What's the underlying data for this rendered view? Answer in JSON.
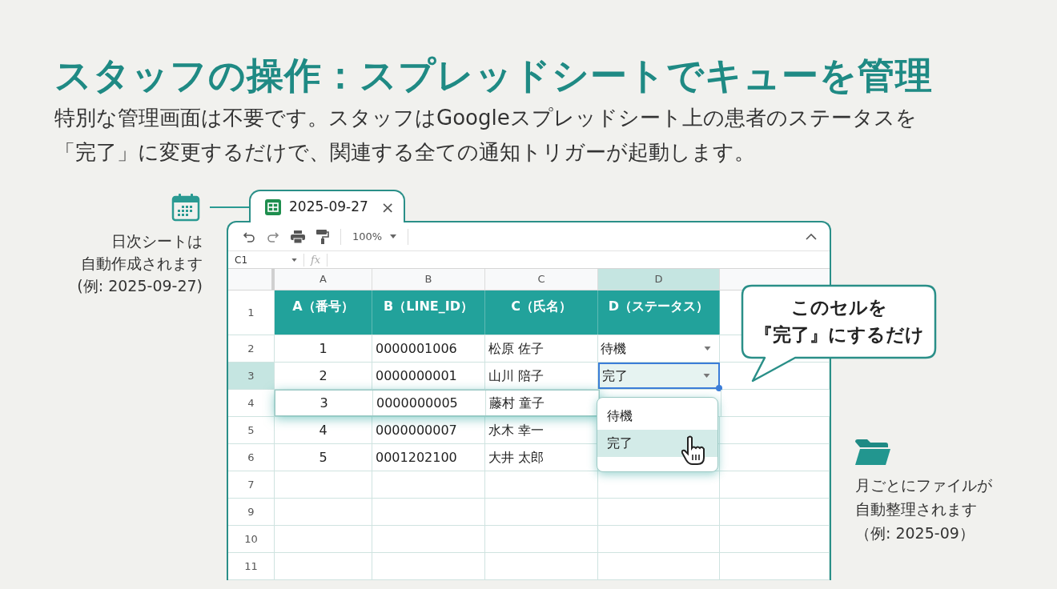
{
  "title": "スタッフの操作：スプレッドシートでキューを管理",
  "description_lines": [
    "特別な管理画面は不要です。スタッフはGoogleスプレッドシート上の患者のステータスを",
    "「完了」に変更するだけで、関連する全ての通知トリガーが起動します。"
  ],
  "daily_note": {
    "lines": [
      "日次シートは",
      "自動作成されます",
      "(例: 2025-09-27)"
    ]
  },
  "sheet": {
    "tab": {
      "title": "2025-09-27",
      "close": "×"
    },
    "zoom": "100%",
    "name_box": "C1",
    "formula_label": "fx",
    "columns": [
      {
        "letter": "A",
        "header": "A（番号）",
        "selected": false
      },
      {
        "letter": "B",
        "header": "B（LINE_ID）",
        "selected": false
      },
      {
        "letter": "C",
        "header": "C（氏名）",
        "selected": false
      },
      {
        "letter": "D",
        "header": "D（ステータス）",
        "selected": true
      }
    ],
    "header_row": "1",
    "rows": [
      {
        "number": "2",
        "cells": [
          "1",
          "0000001006",
          "松原 佐子"
        ],
        "status": "待機",
        "selected": false,
        "raised": false
      },
      {
        "number": "3",
        "cells": [
          "2",
          "0000000001",
          "山川 陪子"
        ],
        "status": "完了",
        "selected": true,
        "raised": false
      },
      {
        "number": "4",
        "cells": [
          "3",
          "0000000005",
          "藤村 童子"
        ],
        "selected": false,
        "raised": true
      },
      {
        "number": "5",
        "cells": [
          "4",
          "0000000007",
          "水木 幸一"
        ],
        "selected": false,
        "raised": false
      },
      {
        "number": "6",
        "cells": [
          "5",
          "0001202100",
          "大井 太郎"
        ],
        "selected": false,
        "raised": false
      }
    ],
    "empty_rows": [
      {
        "number": "7"
      },
      {
        "number": "9"
      },
      {
        "number": "10"
      },
      {
        "number": "11"
      }
    ],
    "dropdown": {
      "options": [
        {
          "label": "待機",
          "hovered": false
        },
        {
          "label": "完了",
          "hovered": true
        }
      ]
    }
  },
  "callout": {
    "lines": [
      "このセルを",
      "『完了』にするだけ"
    ]
  },
  "monthly_note": {
    "lines": [
      "月ごとにファイルが",
      "自動整理されます",
      "（例: 2025-09）"
    ]
  }
}
